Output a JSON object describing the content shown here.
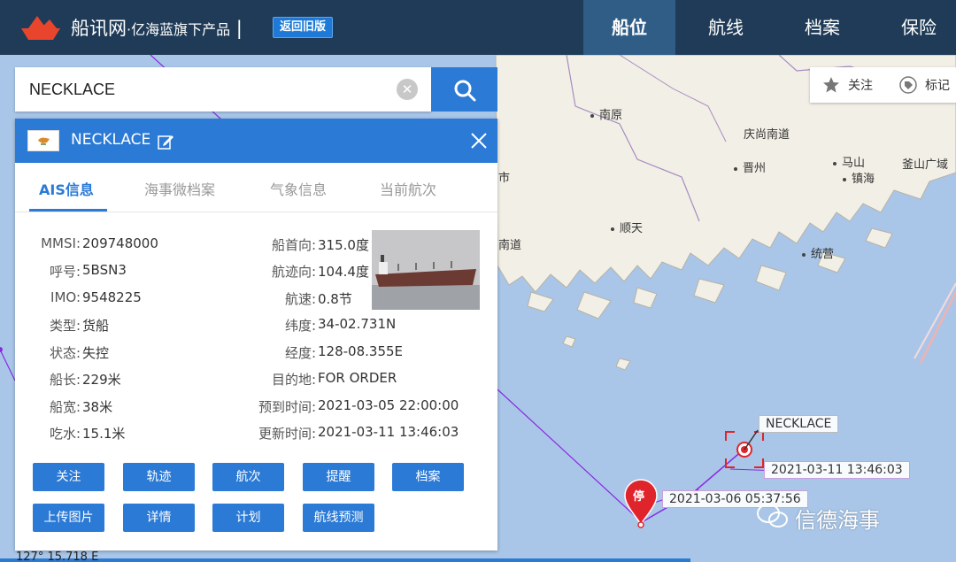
{
  "header": {
    "brand": "船讯网",
    "brand_sub": "·亿海蓝旗下产品",
    "separator": "|",
    "old_version_button": "返回旧版",
    "nav": [
      "船位",
      "航线",
      "档案",
      "保险"
    ]
  },
  "search": {
    "value": "NECKLACE"
  },
  "tools": {
    "follow_label": "关注",
    "mark_label": "标记"
  },
  "panel": {
    "ship_name": "NECKLACE",
    "tabs": [
      "AIS信息",
      "海事微档案",
      "气象信息",
      "当前航次"
    ],
    "active_tab": "AIS信息",
    "left_fields": [
      {
        "label": "MMSI:",
        "value": "209748000"
      },
      {
        "label": "呼号:",
        "value": "5BSN3"
      },
      {
        "label": "IMO:",
        "value": "9548225"
      },
      {
        "label": "类型:",
        "value": "货船"
      },
      {
        "label": "状态:",
        "value": "失控"
      },
      {
        "label": "船长:",
        "value": "229米"
      },
      {
        "label": "船宽:",
        "value": "38米"
      },
      {
        "label": "吃水:",
        "value": "15.1米"
      }
    ],
    "right_fields": [
      {
        "label": "船首向:",
        "value": "315.0度"
      },
      {
        "label": "航迹向:",
        "value": "104.4度"
      },
      {
        "label": "航速:",
        "value": "0.8节"
      },
      {
        "label": "纬度:",
        "value": "34-02.731N"
      },
      {
        "label": "经度:",
        "value": "128-08.355E"
      },
      {
        "label": "目的地:",
        "value": "FOR ORDER"
      },
      {
        "label": "预到时间:",
        "value": "2021-03-05 22:00:00"
      },
      {
        "label": "更新时间:",
        "value": "2021-03-11 13:46:03"
      }
    ],
    "buttons_row1": [
      "关注",
      "轨迹",
      "航次",
      "提醒",
      "档案"
    ],
    "buttons_row2": [
      "上传图片",
      "详情",
      "计划",
      "航线预测"
    ]
  },
  "map": {
    "places": [
      "南原",
      "庆尚南道",
      "晋州",
      "马山",
      "镇海",
      "釜山广域",
      "顺天",
      "统营",
      "南道",
      "市"
    ],
    "ship_label": "NECKLACE",
    "time_label_1": "2021-03-11 13:46:03",
    "time_label_2": "2021-03-06 05:37:56",
    "stop_marker": "停",
    "coord_readout": "127° 15.718 E"
  },
  "watermark": "信德海事",
  "colors": {
    "accent": "#2b7ad6",
    "header_bg": "#1f3b57",
    "track": "#8a2be2",
    "marker_red": "#e0242c"
  }
}
